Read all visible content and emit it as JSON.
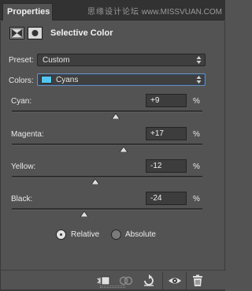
{
  "tab": {
    "label": "Properties"
  },
  "watermark": {
    "part1": "思缘设计论坛",
    "part2": "www.MISSVUAN.COM"
  },
  "header": {
    "title": "Selective Color"
  },
  "preset": {
    "label": "Preset:",
    "value": "Custom"
  },
  "colors": {
    "label": "Colors:",
    "value": "Cyans",
    "swatch_color": "#52c7f2"
  },
  "sliders": [
    {
      "label": "Cyan:",
      "value": "+9",
      "unit": "%",
      "percent": 9
    },
    {
      "label": "Magenta:",
      "value": "+17",
      "unit": "%",
      "percent": 17
    },
    {
      "label": "Yellow:",
      "value": "-12",
      "unit": "%",
      "percent": -12
    },
    {
      "label": "Black:",
      "value": "-24",
      "unit": "%",
      "percent": -24
    }
  ],
  "mode": {
    "relative_label": "Relative",
    "absolute_label": "Absolute",
    "selected": "relative"
  },
  "footer_icons": [
    "clip-to-layer-icon",
    "view-previous-state-icon",
    "reset-icon",
    "visibility-eye-icon",
    "trash-icon"
  ]
}
